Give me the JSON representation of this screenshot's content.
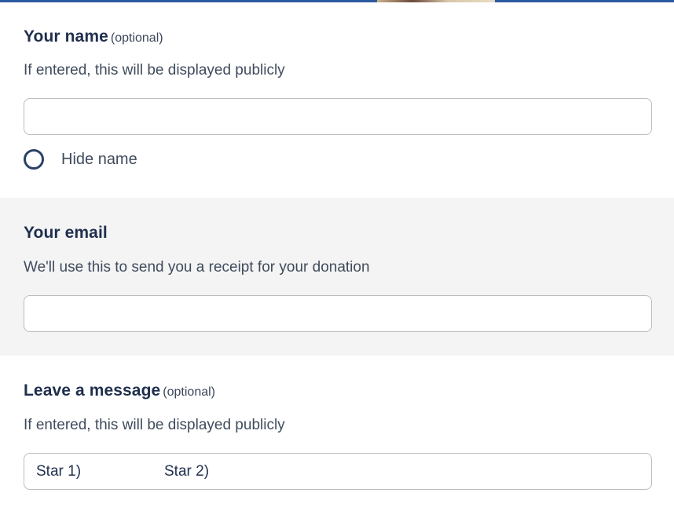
{
  "name_section": {
    "label": "Your name",
    "optional": "(optional)",
    "help": "If entered, this will be displayed publicly",
    "input_value": "",
    "hide_name_label": "Hide name"
  },
  "email_section": {
    "label": "Your email",
    "help": "We'll use this to send you a receipt for your donation",
    "input_value": ""
  },
  "message_section": {
    "label": "Leave a message",
    "optional": "(optional)",
    "help": "If entered, this will be displayed publicly",
    "message_items": [
      "Star 1)",
      "Star 2)"
    ]
  },
  "colors": {
    "top_bar": "#2c5aa0",
    "heading": "#1f2f4d",
    "gray_section_bg": "#f4f4f4",
    "input_border": "#bdbdbd"
  }
}
